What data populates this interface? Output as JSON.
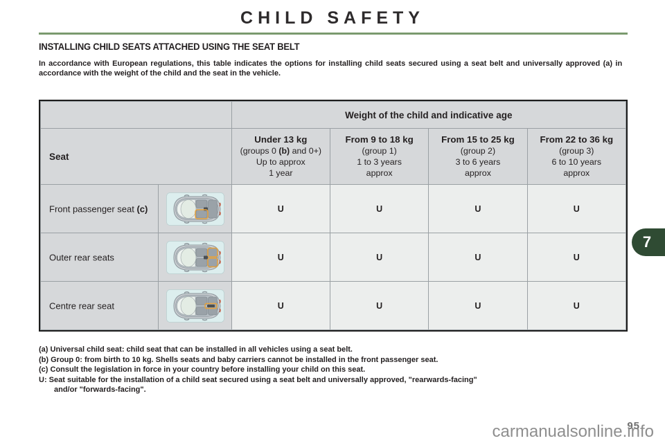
{
  "header": {
    "title": "CHILD SAFETY",
    "rule_color": "#7a9a6e"
  },
  "section": {
    "heading": "INSTALLING CHILD SEATS ATTACHED USING THE SEAT BELT",
    "intro": "In accordance with European regulations, this table indicates the options for installing child seats secured using a seat belt and universally approved (a) in accordance with the weight of the child and the seat in the vehicle."
  },
  "table": {
    "top_header": "Weight of the child and indicative age",
    "seat_header": "Seat",
    "columns": [
      {
        "weight": "Under 13 kg",
        "group_prefix": "(groups 0 ",
        "group_bold": "(b)",
        "group_suffix": " and 0+)",
        "age_line1": "Up to approx",
        "age_line2": "1 year"
      },
      {
        "weight": "From 9 to 18 kg",
        "group_prefix": "(group 1)",
        "group_bold": "",
        "group_suffix": "",
        "age_line1": "1 to 3 years",
        "age_line2": "approx"
      },
      {
        "weight": "From 15 to 25 kg",
        "group_prefix": "(group 2)",
        "group_bold": "",
        "group_suffix": "",
        "age_line1": "3 to 6 years",
        "age_line2": "approx"
      },
      {
        "weight": "From 22 to 36 kg",
        "group_prefix": "(group 3)",
        "group_bold": "",
        "group_suffix": "",
        "age_line1": "6 to 10 years",
        "age_line2": "approx"
      }
    ],
    "rows": [
      {
        "label": "Front passenger seat ",
        "label_note": "(c)",
        "icon": "car-topview-front-passenger-icon",
        "values": [
          "U",
          "U",
          "U",
          "U"
        ]
      },
      {
        "label": "Outer rear seats",
        "label_note": "",
        "icon": "car-topview-outer-rear-icon",
        "values": [
          "U",
          "U",
          "U",
          "U"
        ]
      },
      {
        "label": "Centre rear seat",
        "label_note": "",
        "icon": "car-topview-centre-rear-icon",
        "values": [
          "U",
          "U",
          "U",
          "U"
        ]
      }
    ]
  },
  "footnotes": {
    "a": "(a) Universal child seat: child seat that can be installed in all vehicles using a seat belt.",
    "b": "(b) Group 0: from birth to 10 kg. Shells seats and baby carriers cannot be installed in the front passenger seat.",
    "c": "(c) Consult the legislation in force in your country before installing your child on this seat.",
    "u_line1": "U: Seat suitable for the installation of a child seat secured using a seat belt and universally approved, \"rearwards-facing\"",
    "u_line2": "and/or \"forwards-facing\"."
  },
  "side_tab": {
    "label": "7",
    "color": "#2f4b33"
  },
  "footer": {
    "page_number": "95",
    "watermark": "carmanualsonline.info"
  }
}
